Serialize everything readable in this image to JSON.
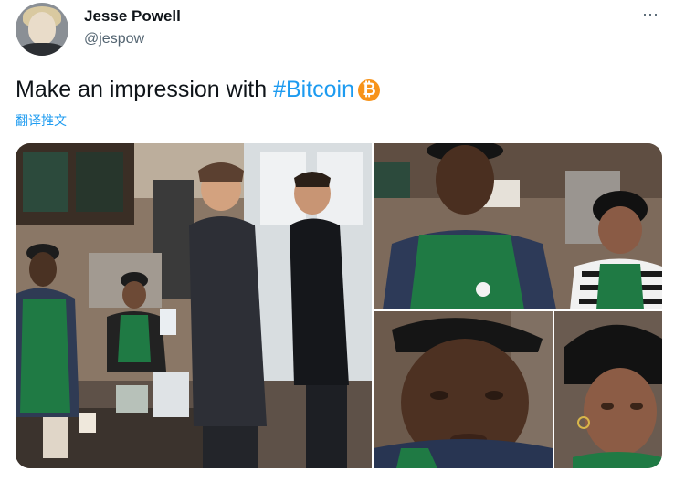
{
  "user": {
    "display_name": "Jesse Powell",
    "handle": "@jespow",
    "avatar_icon": "avatar-photo"
  },
  "more_icon": "⋯",
  "tweet": {
    "text_before": "Make an impression with ",
    "hashtag": "#Bitcoin",
    "emoji": "₿",
    "translate_label": "翻译推文"
  },
  "colors": {
    "link": "#1d9bf0",
    "bitcoin": "#f7931a",
    "secondary_text": "#536471"
  },
  "media": {
    "photos": [
      {
        "icon": "starbucks-counter-photo"
      },
      {
        "icon": "barista-closeup-photo"
      },
      {
        "icon": "barista-face-left-photo"
      },
      {
        "icon": "barista-face-right-photo"
      }
    ]
  }
}
